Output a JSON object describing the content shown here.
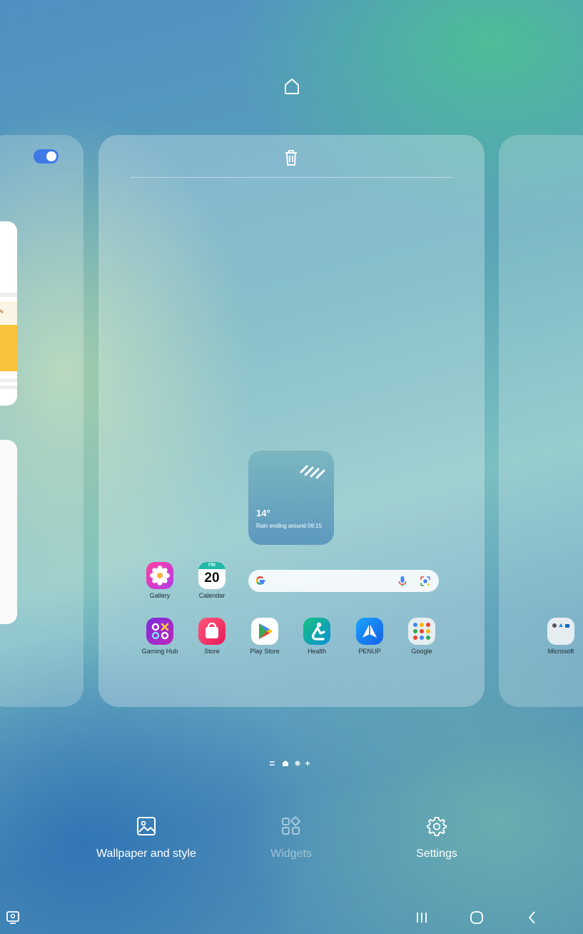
{
  "weather": {
    "temp": "14°",
    "description": "Rain ending around 09:15"
  },
  "calendar": {
    "day_of_week": "FRI",
    "date": "20"
  },
  "row1_apps": [
    {
      "name": "Gallery",
      "icon": "gallery-flower-icon"
    },
    {
      "name": "Calendar",
      "icon": "calendar-icon"
    }
  ],
  "row2_apps": [
    {
      "name": "Gaming Hub",
      "icon": "gaming-hub-icon"
    },
    {
      "name": "Store",
      "icon": "store-bag-icon"
    },
    {
      "name": "Play Store",
      "icon": "play-store-icon"
    },
    {
      "name": "Health",
      "icon": "health-icon"
    },
    {
      "name": "PENUP",
      "icon": "penup-icon"
    },
    {
      "name": "Google",
      "icon": "google-folder-icon"
    }
  ],
  "right_panel": {
    "folder_label": "Microsoft"
  },
  "search_bar": {
    "icons": [
      "google-g-icon",
      "mic-icon",
      "lens-icon"
    ]
  },
  "bottom_actions": [
    {
      "label": "Wallpaper and style",
      "icon": "image-icon",
      "enabled": true
    },
    {
      "label": "Widgets",
      "icon": "widgets-icon",
      "enabled": false
    },
    {
      "label": "Settings",
      "icon": "gear-icon",
      "enabled": true
    }
  ],
  "page_indicator": {
    "pages": [
      "menu",
      "home",
      "page",
      "add"
    ],
    "current": 1
  },
  "colors": {
    "toggle_on": "#3e79e6",
    "accent_white": "#ffffff"
  }
}
